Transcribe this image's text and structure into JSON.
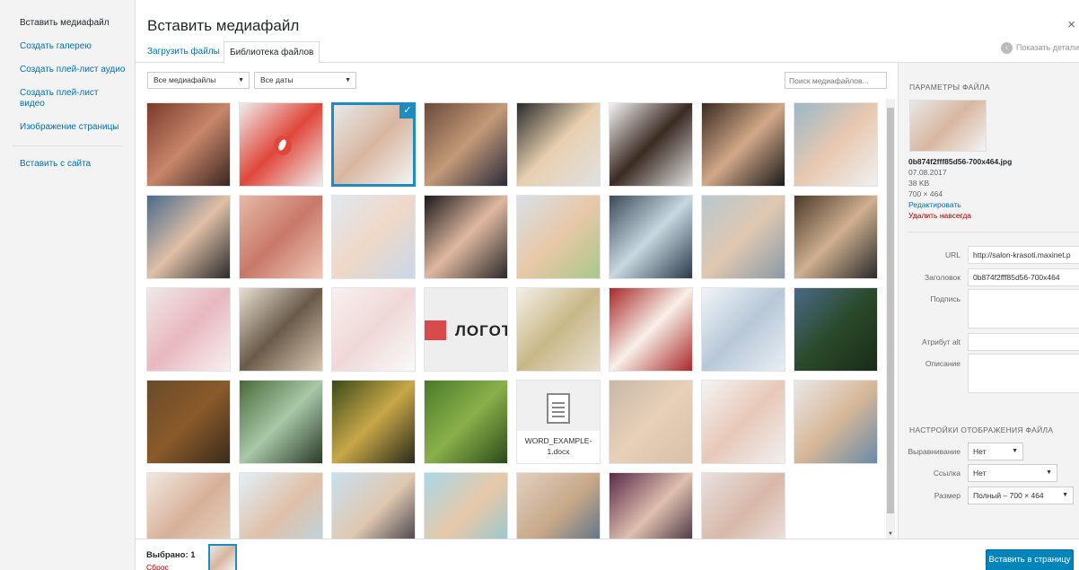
{
  "sidebar": {
    "items": [
      {
        "label": "Вставить медиафайл",
        "active": true
      },
      {
        "label": "Создать галерею"
      },
      {
        "label": "Создать плей-лист аудио"
      },
      {
        "label": "Создать плей-лист видео"
      },
      {
        "label": "Изображение страницы"
      },
      {
        "label": "Вставить с сайта"
      }
    ]
  },
  "header": {
    "title": "Вставить медиафайл",
    "close": "×",
    "collapse_label": "Показать детали"
  },
  "tabs": [
    {
      "label": "Загрузить файлы"
    },
    {
      "label": "Библиотека файлов",
      "active": true
    }
  ],
  "toolbar": {
    "type_filter": "Все медиафайлы",
    "date_filter": "Все даты",
    "search_placeholder": "Поиск медиафайлов..."
  },
  "attachments": [
    {
      "kind": "image",
      "desc": "massage",
      "colors": [
        "#7a3a2a",
        "#c8866a",
        "#3a2620"
      ]
    },
    {
      "kind": "logo",
      "desc": "red oval logo",
      "colors": [
        "#eeeeee",
        "#e0473a",
        "#eeeeee"
      ]
    },
    {
      "kind": "image",
      "desc": "woman with brushes",
      "colors": [
        "#e8e8e8",
        "#d8b6a0",
        "#f4f4f4"
      ],
      "selected": true
    },
    {
      "kind": "image",
      "desc": "salon worker",
      "colors": [
        "#6a4a3a",
        "#c49a78",
        "#2a2a3a"
      ]
    },
    {
      "kind": "image",
      "desc": "blonde stylist",
      "colors": [
        "#2a2a2a",
        "#e8d0b0",
        "#e0e0e0"
      ]
    },
    {
      "kind": "image",
      "desc": "hairdresser",
      "colors": [
        "#f4f4f4",
        "#3a2a22",
        "#e0e0e0"
      ]
    },
    {
      "kind": "image",
      "desc": "brunette portrait",
      "colors": [
        "#3a2a22",
        "#d2a888",
        "#1a1a1a"
      ]
    },
    {
      "kind": "image",
      "desc": "face treatment",
      "colors": [
        "#9ab8c8",
        "#e8c8b0",
        "#f0f0f0"
      ]
    },
    {
      "kind": "image",
      "desc": "laser treatment",
      "colors": [
        "#4a6a8a",
        "#e0c0a8",
        "#2a2a2a"
      ]
    },
    {
      "kind": "image",
      "desc": "lips injection",
      "colors": [
        "#e8b8a8",
        "#c87868",
        "#f0c8b8"
      ]
    },
    {
      "kind": "image",
      "desc": "manicure",
      "colors": [
        "#e0e8f0",
        "#f0d8c8",
        "#c8d8e8"
      ]
    },
    {
      "kind": "image",
      "desc": "nails",
      "colors": [
        "#1a1a1a",
        "#e0b8a0",
        "#2a2a2a"
      ]
    },
    {
      "kind": "image",
      "desc": "face masks",
      "colors": [
        "#d8e0e8",
        "#e8c8a8",
        "#a8c888"
      ]
    },
    {
      "kind": "image",
      "desc": "hair washing",
      "colors": [
        "#3a4a5a",
        "#c8d8e0",
        "#2a3a4a"
      ]
    },
    {
      "kind": "image",
      "desc": "hair wash",
      "colors": [
        "#b8c8d0",
        "#e0c8b0",
        "#8a9aa8"
      ]
    },
    {
      "kind": "image",
      "desc": "hair styling",
      "colors": [
        "#4a3a2a",
        "#d0b090",
        "#2a2a2a"
      ]
    },
    {
      "kind": "image",
      "desc": "face mask pink",
      "colors": [
        "#f0e8e8",
        "#e8b8c0",
        "#f8f0f0"
      ]
    },
    {
      "kind": "image",
      "desc": "salon interior",
      "colors": [
        "#e8e0d0",
        "#6a5a4a",
        "#d8c8b0"
      ]
    },
    {
      "kind": "image",
      "desc": "soft pink",
      "colors": [
        "#f8f0f0",
        "#f0d8d8",
        "#fafafa"
      ]
    },
    {
      "kind": "logotext",
      "desc": "logo",
      "text": "ЛОГОТ",
      "colors": [
        "#eeeeee",
        "#eeeeee",
        "#eeeeee"
      ]
    },
    {
      "kind": "image",
      "desc": "certificate",
      "colors": [
        "#f4f0e8",
        "#c8b888",
        "#e8e0d0"
      ]
    },
    {
      "kind": "image",
      "desc": "diploma",
      "colors": [
        "#a8282a",
        "#f8f0e8",
        "#a8282a"
      ]
    },
    {
      "kind": "image",
      "desc": "certificate blue",
      "colors": [
        "#f0f4f8",
        "#b8c8d8",
        "#e8eef4"
      ]
    },
    {
      "kind": "image",
      "desc": "forest",
      "colors": [
        "#4a6a88",
        "#2a4a2a",
        "#1a2a1a"
      ]
    },
    {
      "kind": "image",
      "desc": "autumn forest",
      "colors": [
        "#6a4a2a",
        "#8a5a2a",
        "#3a2a1a"
      ]
    },
    {
      "kind": "image",
      "desc": "sunlit forest",
      "colors": [
        "#4a6a3a",
        "#a8c8a8",
        "#2a3a2a"
      ]
    },
    {
      "kind": "image",
      "desc": "forest sun",
      "colors": [
        "#3a4a1a",
        "#c8a848",
        "#2a2a1a"
      ]
    },
    {
      "kind": "image",
      "desc": "green path",
      "colors": [
        "#4a7a2a",
        "#8ab04a",
        "#2a4a1a"
      ]
    },
    {
      "kind": "doc",
      "desc": "document",
      "filename": "WORD_EXAMPLE-1.docx"
    },
    {
      "kind": "image",
      "desc": "blonde model",
      "colors": [
        "#c8b8a8",
        "#e8d0b8",
        "#d8c0a8"
      ]
    },
    {
      "kind": "image",
      "desc": "red lips model",
      "colors": [
        "#f4f4f4",
        "#e8c8b8",
        "#f0f0f0"
      ]
    },
    {
      "kind": "image",
      "desc": "slim waist",
      "colors": [
        "#e8e8e8",
        "#d8b898",
        "#6a8aa8"
      ]
    },
    {
      "kind": "image",
      "desc": "face care",
      "colors": [
        "#f0e8e0",
        "#d8b098",
        "#e8d8c8"
      ]
    },
    {
      "kind": "image",
      "desc": "injection",
      "colors": [
        "#e0f0f8",
        "#e0c0a8",
        "#b8d8e8"
      ]
    },
    {
      "kind": "image",
      "desc": "eyebrow",
      "colors": [
        "#c8e0f0",
        "#e0c8b0",
        "#2a2a3a"
      ]
    },
    {
      "kind": "image",
      "desc": "hands",
      "colors": [
        "#a8d8e8",
        "#e8c8a8",
        "#88c8d8"
      ]
    },
    {
      "kind": "image",
      "desc": "jeans waist",
      "colors": [
        "#e0d0c0",
        "#c8a888",
        "#4a6a8a"
      ]
    },
    {
      "kind": "image",
      "desc": "dark model",
      "colors": [
        "#5a2a4a",
        "#e0c0b0",
        "#2a1a2a"
      ]
    },
    {
      "kind": "image",
      "desc": "portrait",
      "colors": [
        "#e8e0e0",
        "#d8b8a8",
        "#f0e8e8"
      ]
    }
  ],
  "details": {
    "heading": "ПАРАМЕТРЫ ФАЙЛА",
    "filename": "0b874f2fff85d56-700x464.jpg",
    "date": "07.08.2017",
    "size": "38 KB",
    "dimensions": "700 × 464",
    "edit_label": "Редактировать",
    "delete_label": "Удалить навсегда",
    "url_label": "URL",
    "url_value": "http://salon-krasoti.maxinet.p",
    "title_label": "Заголовок",
    "title_value": "0b874f2fff85d56-700x464",
    "caption_label": "Подпись",
    "alt_label": "Атрибут alt",
    "description_label": "Описание"
  },
  "display": {
    "heading": "НАСТРОЙКИ ОТОБРАЖЕНИЯ ФАЙЛА",
    "align_label": "Выравнивание",
    "align_value": "Нет",
    "link_label": "Ссылка",
    "link_value": "Нет",
    "size_label": "Размер",
    "size_value": "Полный – 700 × 464"
  },
  "footer": {
    "selected_label": "Выбрано: 1",
    "reset_label": "Сброс",
    "insert_label": "Вставить в страницу"
  },
  "colors": {
    "accent": "#0073aa",
    "selected": "#1e8cbe",
    "primary_button": "#0085ba",
    "danger": "#a00"
  }
}
